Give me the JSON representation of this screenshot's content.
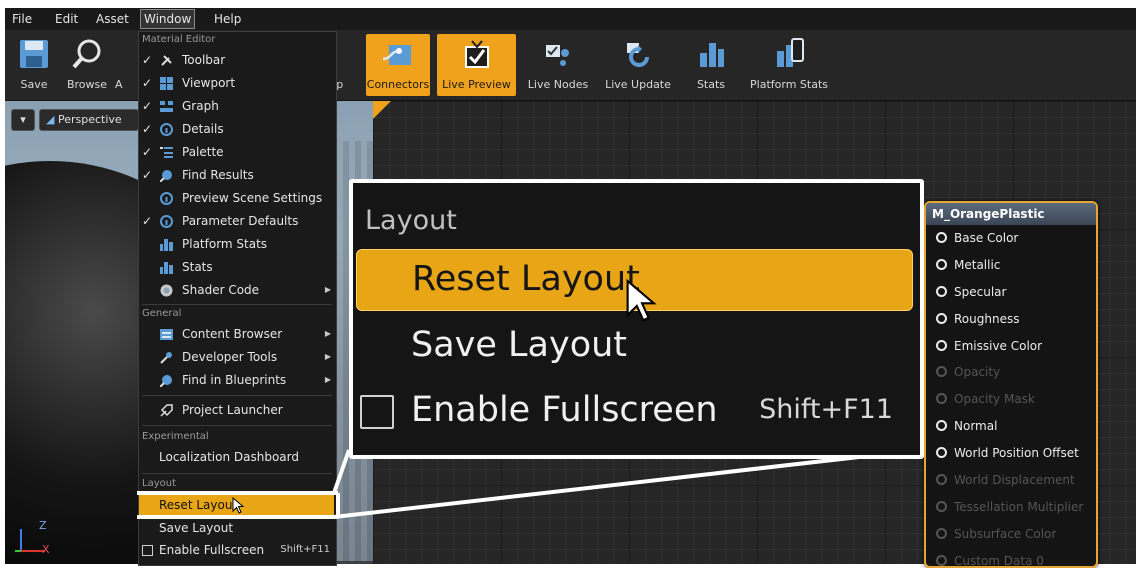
{
  "menubar": {
    "file": "File",
    "edit": "Edit",
    "asset": "Asset",
    "window": "Window",
    "help": "Help"
  },
  "toolbar": {
    "save": "Save",
    "browse": "Browse",
    "a_frag": "A",
    "up_frag": "Ip",
    "connectors": "Connectors",
    "live_preview": "Live Preview",
    "live_nodes": "Live Nodes",
    "live_update": "Live Update",
    "stats": "Stats",
    "platform_stats": "Platform Stats",
    "accent": "#f0a21d"
  },
  "viewport": {
    "perspective": "Perspective",
    "axis_z": "Z",
    "axis_x": "X"
  },
  "window_menu": {
    "sections": {
      "material_editor": "Material Editor",
      "general": "General",
      "experimental": "Experimental",
      "layout": "Layout"
    },
    "items": [
      {
        "label": "Toolbar",
        "checked": "✓",
        "icon": "wrench-icon"
      },
      {
        "label": "Viewport",
        "checked": "✓",
        "icon": "viewport-icon"
      },
      {
        "label": "Graph",
        "checked": "✓",
        "icon": "graph-icon"
      },
      {
        "label": "Details",
        "checked": "✓",
        "icon": "details-icon"
      },
      {
        "label": "Palette",
        "checked": "✓",
        "icon": "palette-icon"
      },
      {
        "label": "Find Results",
        "checked": "✓",
        "icon": "find-icon"
      },
      {
        "label": "Preview Scene Settings",
        "checked": "",
        "icon": "details-icon"
      },
      {
        "label": "Parameter Defaults",
        "checked": "✓",
        "icon": "details-icon"
      },
      {
        "label": "Platform Stats",
        "checked": "",
        "icon": "stats-icon"
      },
      {
        "label": "Stats",
        "checked": "",
        "icon": "stats-icon"
      },
      {
        "label": "Shader Code",
        "checked": "",
        "icon": "shader-icon"
      }
    ],
    "general_items": [
      {
        "label": "Content Browser",
        "icon": "content-browser-icon"
      },
      {
        "label": "Developer Tools",
        "icon": "developer-tools-icon"
      },
      {
        "label": "Find in Blueprints",
        "icon": "find-icon"
      },
      {
        "label": "Project Launcher",
        "icon": "launcher-icon"
      }
    ],
    "localization": "Localization Dashboard",
    "reset_layout": "Reset Layout",
    "save_layout": "Save Layout",
    "enable_fullscreen": "Enable Fullscreen",
    "fullscreen_shortcut": "Shift+F11",
    "submenu_arrow": "▶"
  },
  "callout": {
    "heading": "Layout",
    "reset_layout": "Reset Layout",
    "save_layout": "Save Layout",
    "enable_fullscreen": "Enable Fullscreen",
    "fullscreen_shortcut": "Shift+F11"
  },
  "node": {
    "title": "M_OrangePlastic",
    "pins": [
      {
        "label": "Base Color",
        "enabled": true
      },
      {
        "label": "Metallic",
        "enabled": true
      },
      {
        "label": "Specular",
        "enabled": true
      },
      {
        "label": "Roughness",
        "enabled": true
      },
      {
        "label": "Emissive Color",
        "enabled": true
      },
      {
        "label": "Opacity",
        "enabled": false
      },
      {
        "label": "Opacity Mask",
        "enabled": false
      },
      {
        "label": "Normal",
        "enabled": true
      },
      {
        "label": "World Position Offset",
        "enabled": true
      },
      {
        "label": "World Displacement",
        "enabled": false
      },
      {
        "label": "Tessellation Multiplier",
        "enabled": false
      },
      {
        "label": "Subsurface Color",
        "enabled": false
      },
      {
        "label": "Custom Data 0",
        "enabled": false
      }
    ]
  }
}
